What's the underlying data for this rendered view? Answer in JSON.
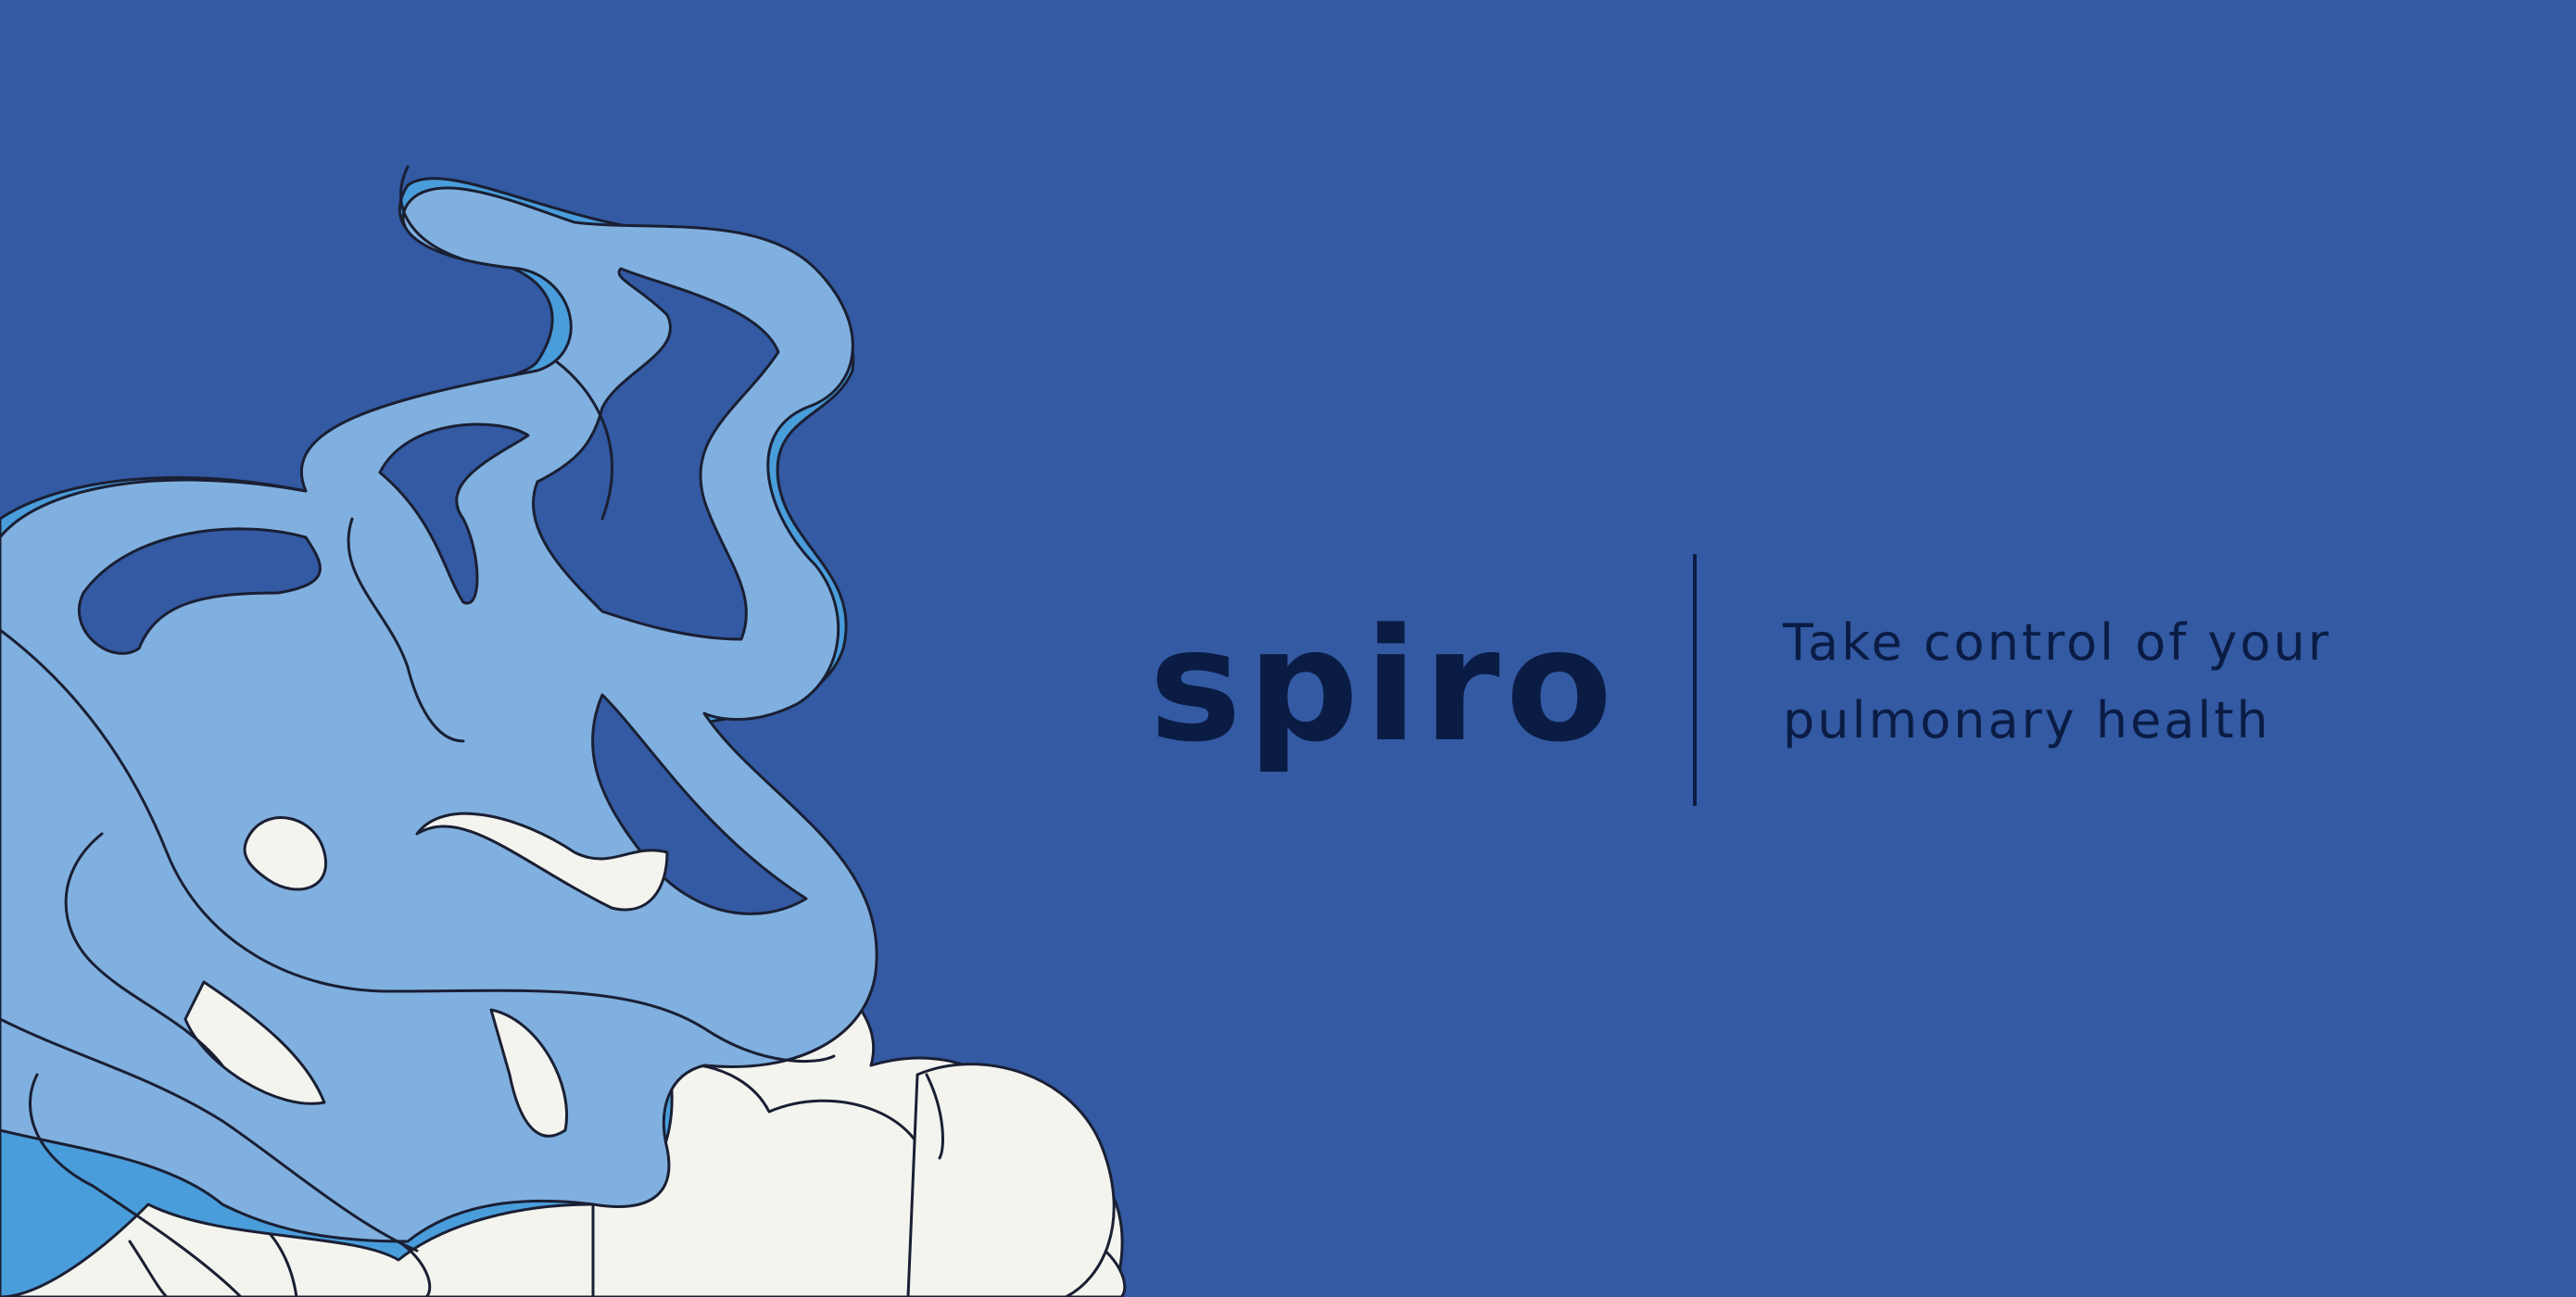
{
  "brand": {
    "name": "spiro"
  },
  "tagline": {
    "line1": "Take control of your",
    "line2": "pulmonary health"
  },
  "colors": {
    "background": "#335aa3",
    "ink": "#0b1c44",
    "lung_light_blue": "#80b0df",
    "lung_mid_blue": "#4a9ddb",
    "cloud_cream": "#f4f4ef"
  },
  "icons": {
    "illustration": "lungs-airflow-illustration"
  }
}
